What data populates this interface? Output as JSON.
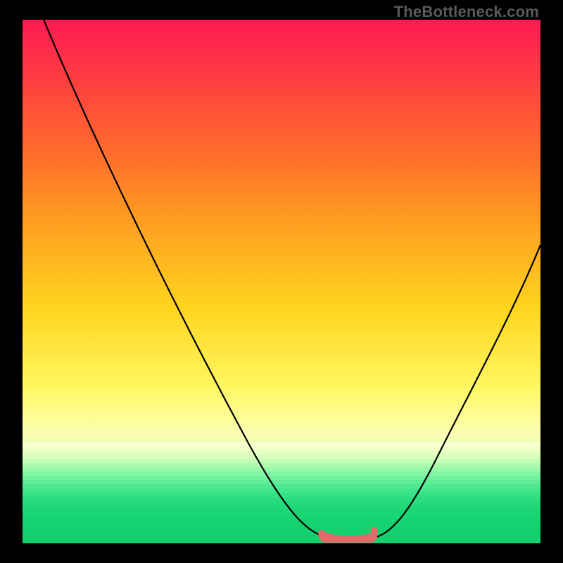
{
  "watermark": "TheBottleneck.com",
  "colors": {
    "frame": "#000000",
    "curve": "#000000",
    "flat_marker": "#e46a6a",
    "gradient_top": "#ff1a52",
    "gradient_bottom": "#17d973"
  },
  "chart_data": {
    "type": "line",
    "title": "",
    "xlabel": "",
    "ylabel": "",
    "xlim": [
      0,
      100
    ],
    "ylim": [
      0,
      100
    ],
    "grid": false,
    "series": [
      {
        "name": "bottleneck-curve",
        "x": [
          4,
          10,
          20,
          30,
          40,
          45,
          50,
          55,
          58,
          60,
          62,
          64,
          66,
          70,
          75,
          80,
          85,
          90,
          96
        ],
        "y": [
          100,
          87,
          70,
          54,
          36,
          27,
          18,
          9,
          4,
          1,
          0,
          0,
          1,
          4,
          12,
          22,
          33,
          45,
          57
        ]
      }
    ],
    "annotations": [
      {
        "name": "optimal-flat-region",
        "x_start": 58,
        "x_end": 66,
        "y": 0
      }
    ]
  }
}
